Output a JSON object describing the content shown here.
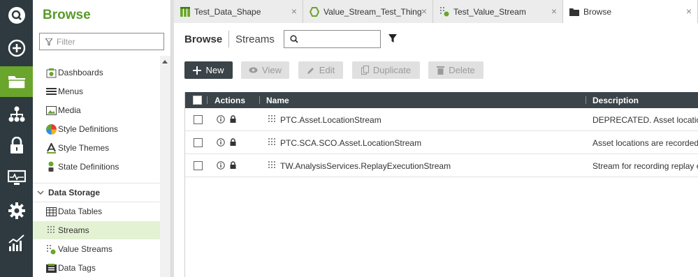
{
  "colors": {
    "rail": "#2e3a40",
    "accent": "#6aa52c",
    "header": "#3a4449",
    "selected": "#e4f2d4"
  },
  "rail": {
    "items": [
      {
        "icon": "search-icon"
      },
      {
        "icon": "add-icon"
      },
      {
        "icon": "folder-icon",
        "active": true
      },
      {
        "icon": "hierarchy-icon"
      },
      {
        "icon": "lock-icon"
      },
      {
        "icon": "monitor-icon"
      },
      {
        "icon": "gear-icon"
      },
      {
        "icon": "analytics-icon"
      }
    ]
  },
  "browse": {
    "title": "Browse",
    "filter_placeholder": "Filter",
    "items": [
      {
        "label": "Dashboards",
        "icon": "dashboard-icon"
      },
      {
        "label": "Menus",
        "icon": "menu-icon"
      },
      {
        "label": "Media",
        "icon": "media-icon"
      },
      {
        "label": "Style Definitions",
        "icon": "palette-icon"
      },
      {
        "label": "Style Themes",
        "icon": "style-theme-icon"
      },
      {
        "label": "State Definitions",
        "icon": "state-icon"
      }
    ],
    "section": "Data Storage",
    "storage_items": [
      {
        "label": "Data Tables",
        "icon": "table-icon"
      },
      {
        "label": "Streams",
        "icon": "stream-icon",
        "selected": true
      },
      {
        "label": "Value Streams",
        "icon": "value-stream-icon"
      },
      {
        "label": "Data Tags",
        "icon": "tag-icon"
      }
    ]
  },
  "tabs": [
    {
      "label": "Test_Data_Shape",
      "icon": "data-shape-icon",
      "close": "×"
    },
    {
      "label": "Value_Stream_Test_Thing",
      "icon": "thing-icon",
      "close": "×"
    },
    {
      "label": "Test_Value_Stream",
      "icon": "value-stream-icon",
      "close": "×"
    },
    {
      "label": "Browse",
      "icon": "folder-icon",
      "close": "×",
      "active": true
    }
  ],
  "main": {
    "breadcrumb": "Browse",
    "entity": "Streams",
    "search_placeholder": "",
    "buttons": {
      "new": "New",
      "view": "View",
      "edit": "Edit",
      "duplicate": "Duplicate",
      "delete": "Delete"
    },
    "columns": {
      "actions": "Actions",
      "name": "Name",
      "description": "Description"
    },
    "rows": [
      {
        "name": "PTC.Asset.LocationStream",
        "description": "DEPRECATED. Asset locations"
      },
      {
        "name": "PTC.SCA.SCO.Asset.LocationStream",
        "description": "Asset locations are recorded to"
      },
      {
        "name": "TW.AnalysisServices.ReplayExecutionStream",
        "description": "Stream for recording replay exe"
      }
    ]
  }
}
